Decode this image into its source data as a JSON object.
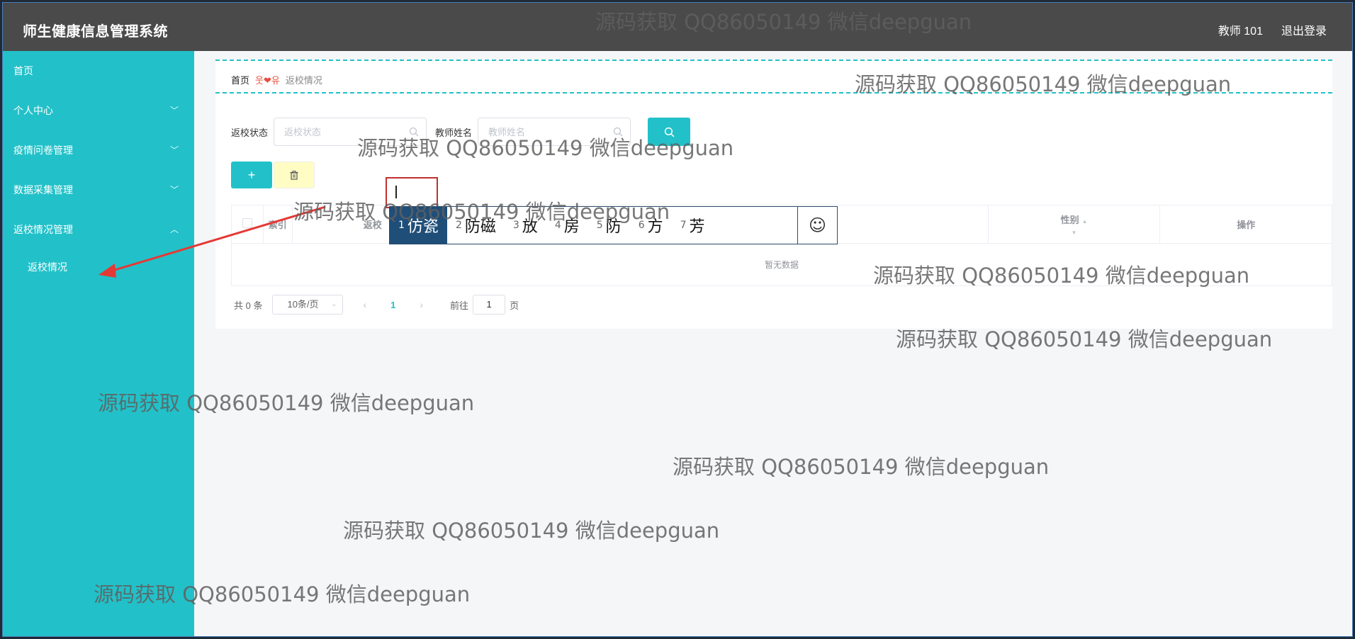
{
  "app": {
    "title": "师生健康信息管理系统"
  },
  "header": {
    "user": "教师 101",
    "logout": "退出登录"
  },
  "sidebar": {
    "items": [
      {
        "label": "首页",
        "chevron": ""
      },
      {
        "label": "个人中心",
        "chevron": "﹀"
      },
      {
        "label": "疫情问卷管理",
        "chevron": "﹀"
      },
      {
        "label": "数据采集管理",
        "chevron": "﹀"
      },
      {
        "label": "返校情况管理",
        "chevron": "︿"
      }
    ],
    "sub_items": [
      {
        "label": "返校情况"
      }
    ]
  },
  "breadcrumb": {
    "home": "首页",
    "separator": "웃❤유",
    "current": "返校情况"
  },
  "search": {
    "status_label": "返校状态",
    "status_placeholder": "返校状态",
    "name_label": "教师姓名",
    "name_placeholder": "教师姓名"
  },
  "actions": {
    "add": "+"
  },
  "table": {
    "headers": {
      "index": "索引",
      "col2": "返校",
      "gender": "性别",
      "ops": "操作"
    },
    "empty": "暂无数据"
  },
  "pagination": {
    "total": "共 0 条",
    "page_size": "10条/页",
    "current_page": "1",
    "goto_label": "前往",
    "goto_value": "1",
    "page_suffix": "页",
    "prev": "‹",
    "next": "›",
    "dropdown": "⌄"
  },
  "ime": {
    "candidates": [
      {
        "num": "1",
        "text": "仿瓷"
      },
      {
        "num": "2",
        "text": "防磁"
      },
      {
        "num": "3",
        "text": "放"
      },
      {
        "num": "4",
        "text": "房"
      },
      {
        "num": "5",
        "text": "防"
      },
      {
        "num": "6",
        "text": "方"
      },
      {
        "num": "7",
        "text": "芳"
      }
    ],
    "emoji": "☺"
  },
  "watermark": "源码获取 QQ86050149 微信deepguan",
  "colors": {
    "accent": "#22c1c9",
    "header_bg": "#4a4a4a",
    "ime_active": "#1f4e79"
  }
}
